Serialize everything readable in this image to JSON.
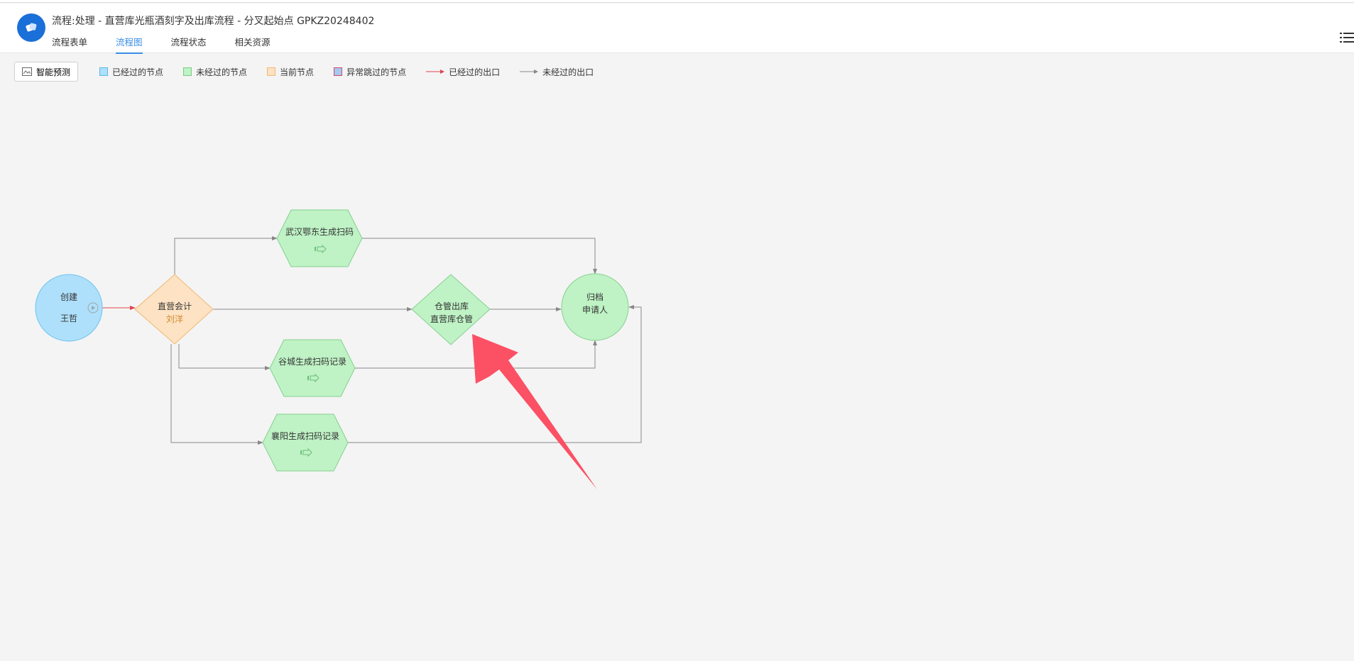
{
  "header": {
    "title": "流程:处理 - 直营库光瓶酒刻字及出库流程 - 分叉起始点 GPKZ20248402",
    "tabs": [
      {
        "label": "流程表单",
        "active": false
      },
      {
        "label": "流程图",
        "active": true
      },
      {
        "label": "流程状态",
        "active": false
      },
      {
        "label": "相关资源",
        "active": false
      }
    ]
  },
  "toolbar": {
    "predict_label": "智能预测"
  },
  "legend": [
    {
      "label": "已经过的节点",
      "fill": "#aee0fb",
      "border": "#5bb6e8"
    },
    {
      "label": "未经过的节点",
      "fill": "#bff2c5",
      "border": "#78cc84"
    },
    {
      "label": "当前节点",
      "fill": "#fde2c3",
      "border": "#f0b772"
    },
    {
      "label": "异常跳过的节点",
      "fill": "#a7c8f0",
      "border": "#d04a6a"
    },
    {
      "label": "已经过的出口",
      "color": "#e0424e"
    },
    {
      "label": "未经过的出口",
      "color": "#888888"
    }
  ],
  "nodes": {
    "start": {
      "line1": "创建",
      "line2": "王哲"
    },
    "accounting": {
      "line1": "直营会计",
      "line2": "刘洋"
    },
    "wuhan": {
      "line1": "武汉鄂东生成扫码"
    },
    "warehouse": {
      "line1": "仓管出库",
      "line2": "直营库仓管"
    },
    "archive": {
      "line1": "归档",
      "line2": "申请人"
    },
    "gucheng": {
      "line1": "谷城生成扫码记录"
    },
    "xiangyang": {
      "line1": "襄阳生成扫码记录"
    }
  },
  "colors": {
    "passed_fill": "#aee0fb",
    "pending_fill": "#bff2c5",
    "current_fill": "#fde2c3",
    "passed_edge": "#e0424e",
    "pending_edge": "#888888",
    "annotation_arrow": "#fc5064"
  }
}
